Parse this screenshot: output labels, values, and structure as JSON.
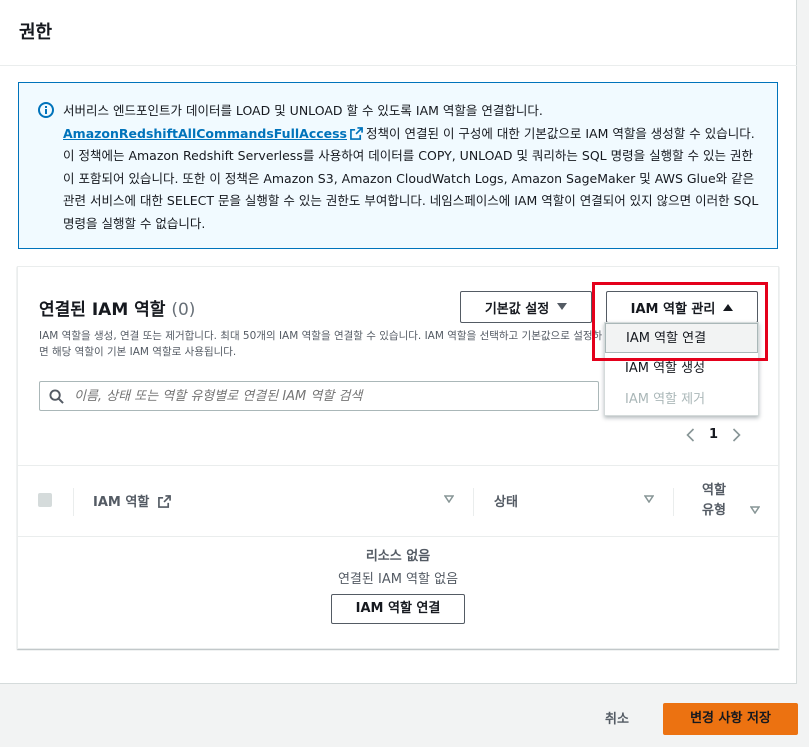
{
  "page": {
    "title": "권한"
  },
  "info": {
    "text_1": "서버리스 엔드포인트가 데이터를 LOAD 및 UNLOAD 할 수 있도록 IAM 역할을 연결합니다.",
    "link": "AmazonRedshiftAllCommandsFullAccess",
    "text_2": "정책이 연결된 이 구성에 대한 기본값으로 IAM 역할을 생성할 수 있습니다. 이 정책에는 Amazon Redshift Serverless를 사용하여 데이터를 COPY, UNLOAD 및 쿼리하는 SQL 명령을 실행할 수 있는 권한이 포함되어 있습니다. 또한 이 정책은 Amazon S3, Amazon CloudWatch Logs, Amazon SageMaker 및 AWS Glue와 같은 관련 서비스에 대한 SELECT 문을 실행할 수 있는 권한도 부여합니다. 네임스페이스에 IAM 역할이 연결되어 있지 않으면 이러한 SQL 명령을 실행할 수 없습니다."
  },
  "panel": {
    "title": "연결된 IAM 역할",
    "count": "(0)",
    "description": "IAM 역할을 생성, 연결 또는 제거합니다. 최대 50개의 IAM 역할을 연결할 수 있습니다. IAM 역할을 선택하고 기본값으로 설정하면 해당 역할이 기본 IAM 역할로 사용됩니다.",
    "set_default_label": "기본값 설정",
    "manage_label": "IAM 역할 관리"
  },
  "search": {
    "placeholder": "이름, 상태 또는 역할 유형별로 연결된 IAM 역할 검색"
  },
  "pagination": {
    "current_page": "1"
  },
  "table": {
    "columns": [
      "IAM 역할",
      "상태",
      "역할",
      "유형"
    ]
  },
  "empty": {
    "title": "리소스 없음",
    "subtitle": "연결된 IAM 역할 없음",
    "button": "IAM 역할 연결"
  },
  "dropdown": {
    "items": [
      "IAM 역할 연결",
      "IAM 역할 생성",
      "IAM 역할 제거"
    ]
  },
  "footer": {
    "cancel": "취소",
    "save": "변경 사항 저장"
  },
  "colors": {
    "accent": "#0073bb",
    "primary_button": "#ec7211",
    "highlight_box": "#e4001b"
  }
}
